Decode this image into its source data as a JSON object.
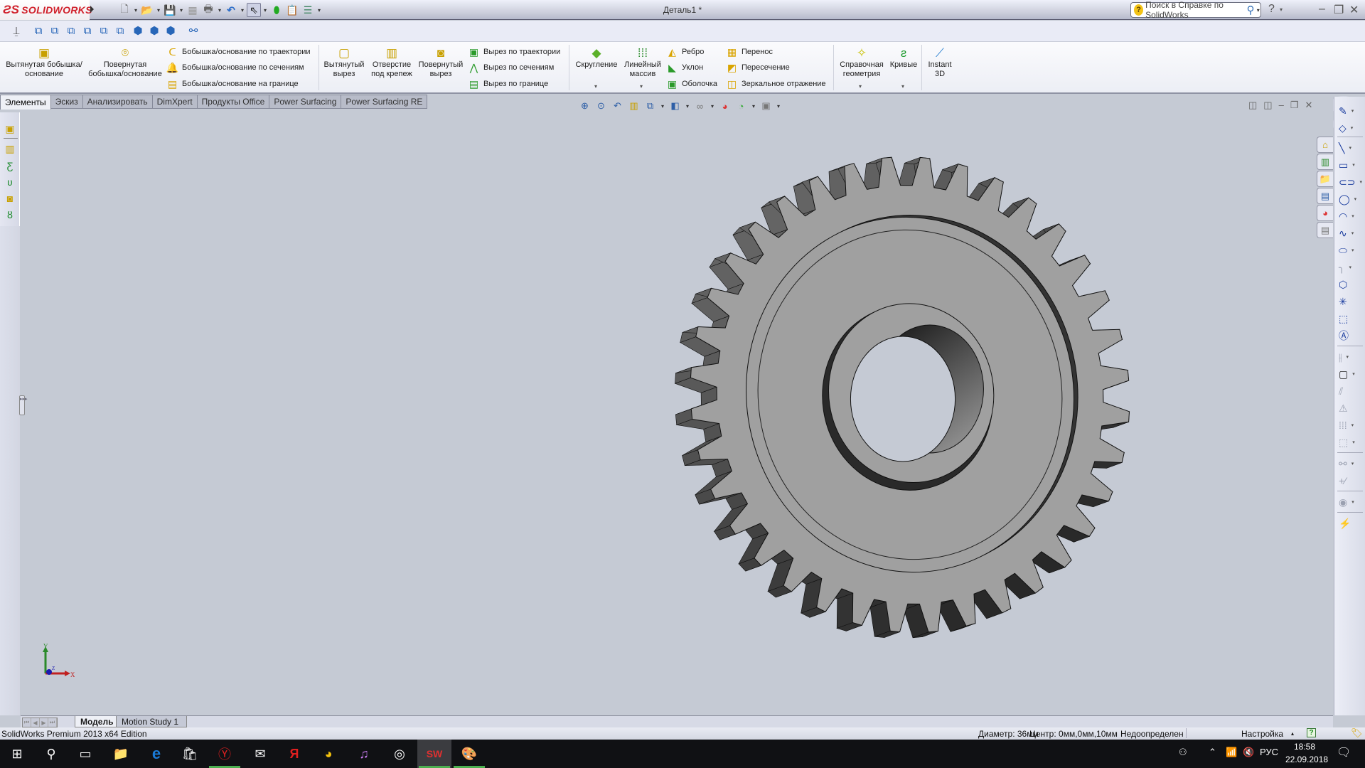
{
  "app": {
    "brand": "SOLIDWORKS",
    "document_title": "Деталь1 *",
    "help_search_placeholder": "Поиск в Справке по SolidWorks"
  },
  "quick_access": [
    {
      "name": "new-document",
      "icon": "new-file-icon"
    },
    {
      "name": "open",
      "icon": "open-folder-icon"
    },
    {
      "name": "save",
      "icon": "save-icon"
    },
    {
      "name": "print-preview",
      "icon": "grid-icon"
    },
    {
      "name": "print",
      "icon": "printer-icon"
    },
    {
      "name": "undo",
      "icon": "undo-icon"
    },
    {
      "name": "select",
      "icon": "cursor-icon"
    },
    {
      "name": "rebuild",
      "icon": "traffic-light-icon"
    },
    {
      "name": "file-properties",
      "icon": "properties-icon"
    },
    {
      "name": "options",
      "icon": "options-icon"
    }
  ],
  "ribbon": {
    "extruded_boss": "Вытянутая бобышка/основание",
    "revolved_boss": "Повернутая бобышка/основание",
    "swept_boss": "Бобышка/основание по траектории",
    "lofted_boss": "Бобышка/основание по сечениям",
    "boundary_boss": "Бобышка/основание на границе",
    "extruded_cut": "Вытянутый вырез",
    "hole_wizard": "Отверстие под крепеж",
    "revolved_cut": "Повернутый вырез",
    "swept_cut": "Вырез по траектории",
    "lofted_cut": "Вырез по сечениям",
    "boundary_cut": "Вырез по границе",
    "fillet": "Скругление",
    "linear_pattern": "Линейный массив",
    "rib": "Ребро",
    "draft": "Уклон",
    "shell": "Оболочка",
    "wrap": "Перенос",
    "intersect": "Пересечение",
    "mirror": "Зеркальное отражение",
    "reference_geometry": "Справочная геометрия",
    "curves": "Кривые",
    "instant3d": "Instant 3D"
  },
  "tabs": [
    "Элементы",
    "Эскиз",
    "Анализировать",
    "DimXpert",
    "Продукты Office",
    "Power Surfacing",
    "Power Surfacing RE"
  ],
  "active_tab": "Элементы",
  "bottom_tabs": [
    "Модель",
    "Motion Study 1"
  ],
  "status": {
    "edition": "SolidWorks Premium 2013 x64 Edition",
    "diameter": "Диаметр: 36мм",
    "center": "Центр: 0мм,0мм,10мм",
    "definition": "Недоопределен",
    "customize": "Настройка",
    "help": "?"
  },
  "model": {
    "type": "spur-gear",
    "teeth": 36,
    "face_color": "#a0a0a0",
    "background_color": "#c5cad4"
  },
  "triad": {
    "x": "X",
    "y": "Y",
    "z": "Z"
  },
  "taskbar": {
    "apps": [
      "start",
      "search",
      "task-view",
      "file-explorer",
      "edge",
      "store",
      "yandex-browser",
      "mail",
      "yandex",
      "chrome",
      "itunes",
      "groove",
      "solidworks",
      "paint"
    ],
    "tray_lang": "РУС",
    "time": "18:58",
    "date": "22.09.2018"
  }
}
